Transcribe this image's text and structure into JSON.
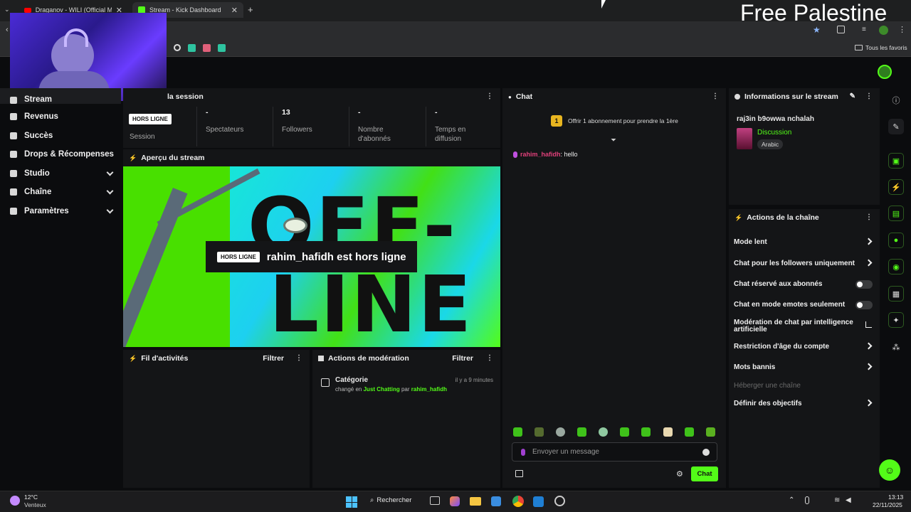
{
  "browser": {
    "tabs": [
      {
        "title": "Draganov - WILI (Official Music",
        "active": false
      },
      {
        "title": "Stream - Kick Dashboard",
        "active": true
      }
    ],
    "bookmarks_folder": "Tous les favoris",
    "overlay_text": "Free Palestine"
  },
  "sidebar": {
    "items": [
      {
        "label": "Stream",
        "icon": "stream-icon"
      },
      {
        "label": "Revenus",
        "icon": "revenue-icon"
      },
      {
        "label": "Succès",
        "icon": "trophy-icon"
      },
      {
        "label": "Drops & Récompenses",
        "icon": "gift-icon"
      },
      {
        "label": "Studio",
        "icon": "studio-icon",
        "expandable": true
      },
      {
        "label": "Chaîne",
        "icon": "channel-icon",
        "expandable": true
      },
      {
        "label": "Paramètres",
        "icon": "gear-icon",
        "expandable": true
      }
    ]
  },
  "session": {
    "title": "la session",
    "status_badge": "HORS LIGNE",
    "session_label": "Session",
    "stats": [
      {
        "value": "-",
        "label": "Spectateurs"
      },
      {
        "value": "13",
        "label": "Followers"
      },
      {
        "value": "-",
        "label": "Nombre d'abonnés"
      },
      {
        "value": "-",
        "label": "Temps en diffusion"
      }
    ]
  },
  "preview": {
    "title": "Aperçu du stream",
    "badge": "HORS LIGNE",
    "message": "rahim_hafidh est hors ligne",
    "bg_text_1": "OFF-",
    "bg_text_2": "LINE"
  },
  "activity": {
    "title": "Fil d'activités",
    "filter": "Filtrer"
  },
  "moderation": {
    "title": "Actions de modération",
    "filter": "Filtrer",
    "entry": {
      "title": "Catégorie",
      "time": "il y a 9 minutes",
      "prefix": "changé en",
      "category": "Just Chatting",
      "by": "par",
      "user": "rahim_hafidh"
    }
  },
  "chat": {
    "title": "Chat",
    "gift_count": "1",
    "gift_text": "Offrir 1 abonnement pour prendre la 1ère",
    "message": {
      "user": "rahim_hafidh",
      "text": ": hello"
    },
    "input_placeholder": "Envoyer un message",
    "send_label": "Chat"
  },
  "stream_info": {
    "title": "Informations sur le stream",
    "stream_title": "raj3in b9owwa nchalah",
    "category": "Discussion",
    "language": "Arabic"
  },
  "channel_actions": {
    "title": "Actions de la chaîne",
    "items": [
      {
        "label": "Mode lent",
        "control": "arrow"
      },
      {
        "label": "Chat pour les followers uniquement",
        "control": "arrow"
      },
      {
        "label": "Chat réservé aux abonnés",
        "control": "toggle"
      },
      {
        "label": "Chat en mode emotes seulement",
        "control": "toggle"
      },
      {
        "label": "Modération de chat par intelligence artificielle",
        "control": "external"
      },
      {
        "label": "Restriction d'âge du compte",
        "control": "arrow"
      },
      {
        "label": "Mots bannis",
        "control": "arrow"
      },
      {
        "label": "Héberger une chaîne",
        "control": "none",
        "disabled": true
      },
      {
        "label": "Définir des objectifs",
        "control": "arrow"
      }
    ]
  },
  "taskbar": {
    "weather_temp": "12°C",
    "weather_desc": "Venteux",
    "search_label": "Rechercher",
    "time": "13:13",
    "date": "22/11/2025"
  },
  "colors": {
    "accent": "#53fc18",
    "background": "#0b0c0e",
    "panel": "#141517"
  }
}
